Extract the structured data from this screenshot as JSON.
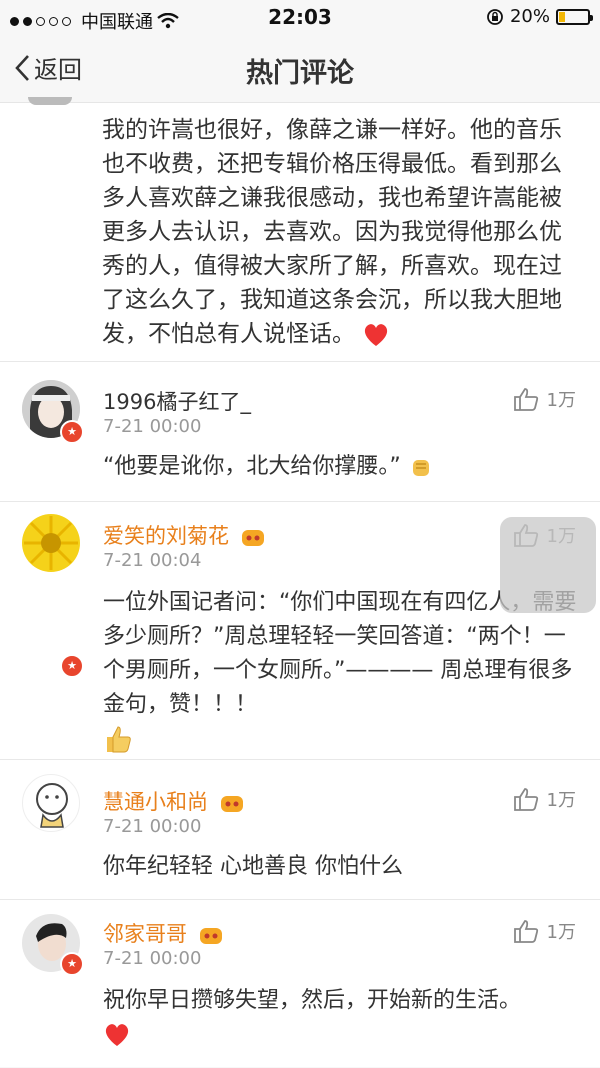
{
  "status": {
    "carrier": "中国联通",
    "time": "22:03",
    "battery": "20%"
  },
  "nav": {
    "back": "返回",
    "title": "热门评论"
  },
  "first_comment": {
    "text": "我的许嵩也很好，像薛之谦一样好。他的音乐也不收费，还把专辑价格压得最低。看到那么多人喜欢薛之谦我很感动，我也希望许嵩能被更多人去认识，去喜欢。因为我觉得他那么优秀的人，值得被大家所了解，所喜欢。现在过了这么久了，我知道这条会沉，所以我大胆地发，不怕总有人说怪话。"
  },
  "comments": [
    {
      "name": "1996橘子红了_",
      "date": "7-21 00:00",
      "likes": "1万",
      "text": "“他要是讹你，北大给你撑腰。”"
    },
    {
      "name": "爱笑的刘菊花",
      "date": "7-21 00:04",
      "likes": "1万",
      "text": "一位外国记者问：“你们中国现在有四亿人，需要多少厕所？”周总理轻轻一笑回答道：“两个！一个男厕所，一个女厕所。”———— 周总理有很多金句，赞！！！"
    },
    {
      "name": "慧通小和尚",
      "date": "7-21 00:00",
      "likes": "1万",
      "text": "你年纪轻轻 心地善良 你怕什么"
    },
    {
      "name": "邻家哥哥",
      "date": "7-21 00:00",
      "likes": "1万",
      "text": "祝你早日攒够失望，然后，开始新的生活。"
    }
  ],
  "colors": {
    "accent_name": "#e8801c",
    "badge": "#e8452d"
  }
}
